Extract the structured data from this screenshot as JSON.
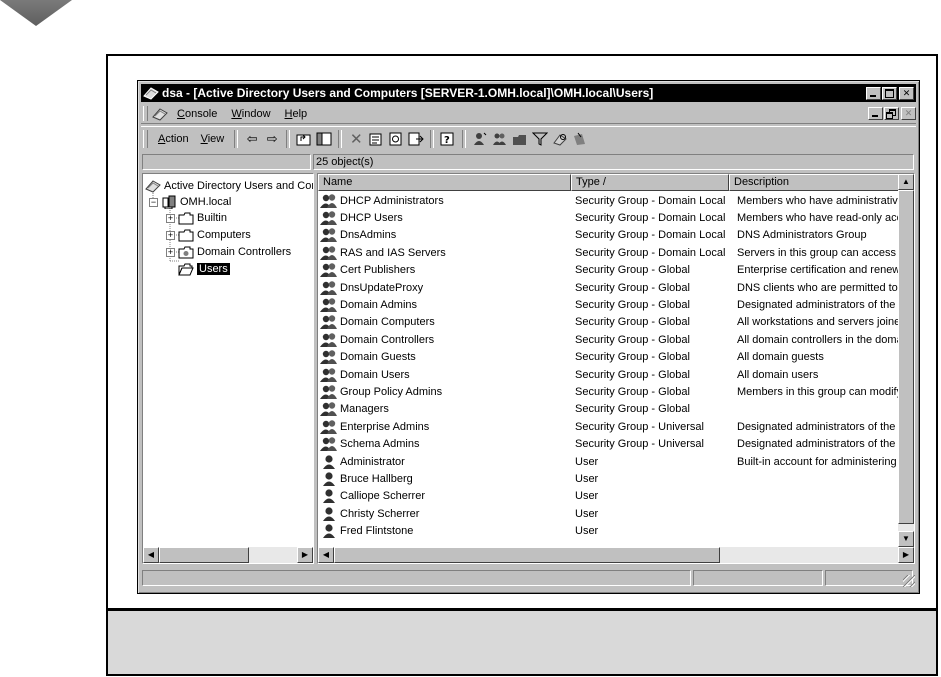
{
  "window": {
    "title": "dsa - [Active Directory Users and Computers [SERVER-1.OMH.local]\\OMH.local\\Users]",
    "colors": {
      "titlebar": "#000000",
      "face": "#c0c0c0",
      "caption_band": "#d9d9d9"
    }
  },
  "menu": {
    "items": [
      {
        "key": "C",
        "rest": "onsole"
      },
      {
        "key": "W",
        "rest": "indow"
      },
      {
        "key": "H",
        "rest": "elp"
      }
    ]
  },
  "toolbar": {
    "action": {
      "key": "A",
      "rest": "ction"
    },
    "view": {
      "key": "V",
      "rest": "iew"
    },
    "back": "⇦",
    "forward": "⇨"
  },
  "status": {
    "object_count": "25 object(s)"
  },
  "tree": {
    "root": "Active Directory Users and Con",
    "domain": "OMH.local",
    "children": [
      "Builtin",
      "Computers",
      "Domain Controllers",
      "Users"
    ]
  },
  "list": {
    "columns": [
      "Name",
      "Type  /",
      "Description"
    ],
    "rows": [
      {
        "name": "DHCP Administrators",
        "type": "Security Group - Domain Local",
        "desc": "Members who have administrative",
        "icon": "group-icon"
      },
      {
        "name": "DHCP Users",
        "type": "Security Group - Domain Local",
        "desc": "Members who have read-only acce",
        "icon": "group-icon"
      },
      {
        "name": "DnsAdmins",
        "type": "Security Group - Domain Local",
        "desc": "DNS Administrators Group",
        "icon": "group-icon"
      },
      {
        "name": "RAS and IAS Servers",
        "type": "Security Group - Domain Local",
        "desc": "Servers in this group can access r",
        "icon": "group-icon"
      },
      {
        "name": "Cert Publishers",
        "type": "Security Group - Global",
        "desc": "Enterprise certification and renewa",
        "icon": "group-icon"
      },
      {
        "name": "DnsUpdateProxy",
        "type": "Security Group - Global",
        "desc": "DNS clients who are permitted to p",
        "icon": "group-icon"
      },
      {
        "name": "Domain Admins",
        "type": "Security Group - Global",
        "desc": "Designated administrators of the d",
        "icon": "group-icon"
      },
      {
        "name": "Domain Computers",
        "type": "Security Group - Global",
        "desc": "All workstations and servers joined",
        "icon": "group-icon"
      },
      {
        "name": "Domain Controllers",
        "type": "Security Group - Global",
        "desc": "All domain controllers in the domair",
        "icon": "group-icon"
      },
      {
        "name": "Domain Guests",
        "type": "Security Group - Global",
        "desc": "All domain guests",
        "icon": "group-icon"
      },
      {
        "name": "Domain Users",
        "type": "Security Group - Global",
        "desc": "All domain users",
        "icon": "group-icon"
      },
      {
        "name": "Group Policy Admins",
        "type": "Security Group - Global",
        "desc": "Members in this group can modify g",
        "icon": "group-icon"
      },
      {
        "name": "Managers",
        "type": "Security Group - Global",
        "desc": "",
        "icon": "group-icon"
      },
      {
        "name": "Enterprise Admins",
        "type": "Security Group - Universal",
        "desc": "Designated administrators of the en",
        "icon": "group-icon"
      },
      {
        "name": "Schema Admins",
        "type": "Security Group - Universal",
        "desc": "Designated administrators of the sc",
        "icon": "group-icon"
      },
      {
        "name": "Administrator",
        "type": "User",
        "desc": "Built-in account for administering th",
        "icon": "user-icon"
      },
      {
        "name": "Bruce Hallberg",
        "type": "User",
        "desc": "",
        "icon": "user-icon"
      },
      {
        "name": "Calliope Scherrer",
        "type": "User",
        "desc": "",
        "icon": "user-icon"
      },
      {
        "name": "Christy Scherrer",
        "type": "User",
        "desc": "",
        "icon": "user-icon"
      },
      {
        "name": "Fred Flintstone",
        "type": "User",
        "desc": "",
        "icon": "user-icon"
      }
    ]
  }
}
